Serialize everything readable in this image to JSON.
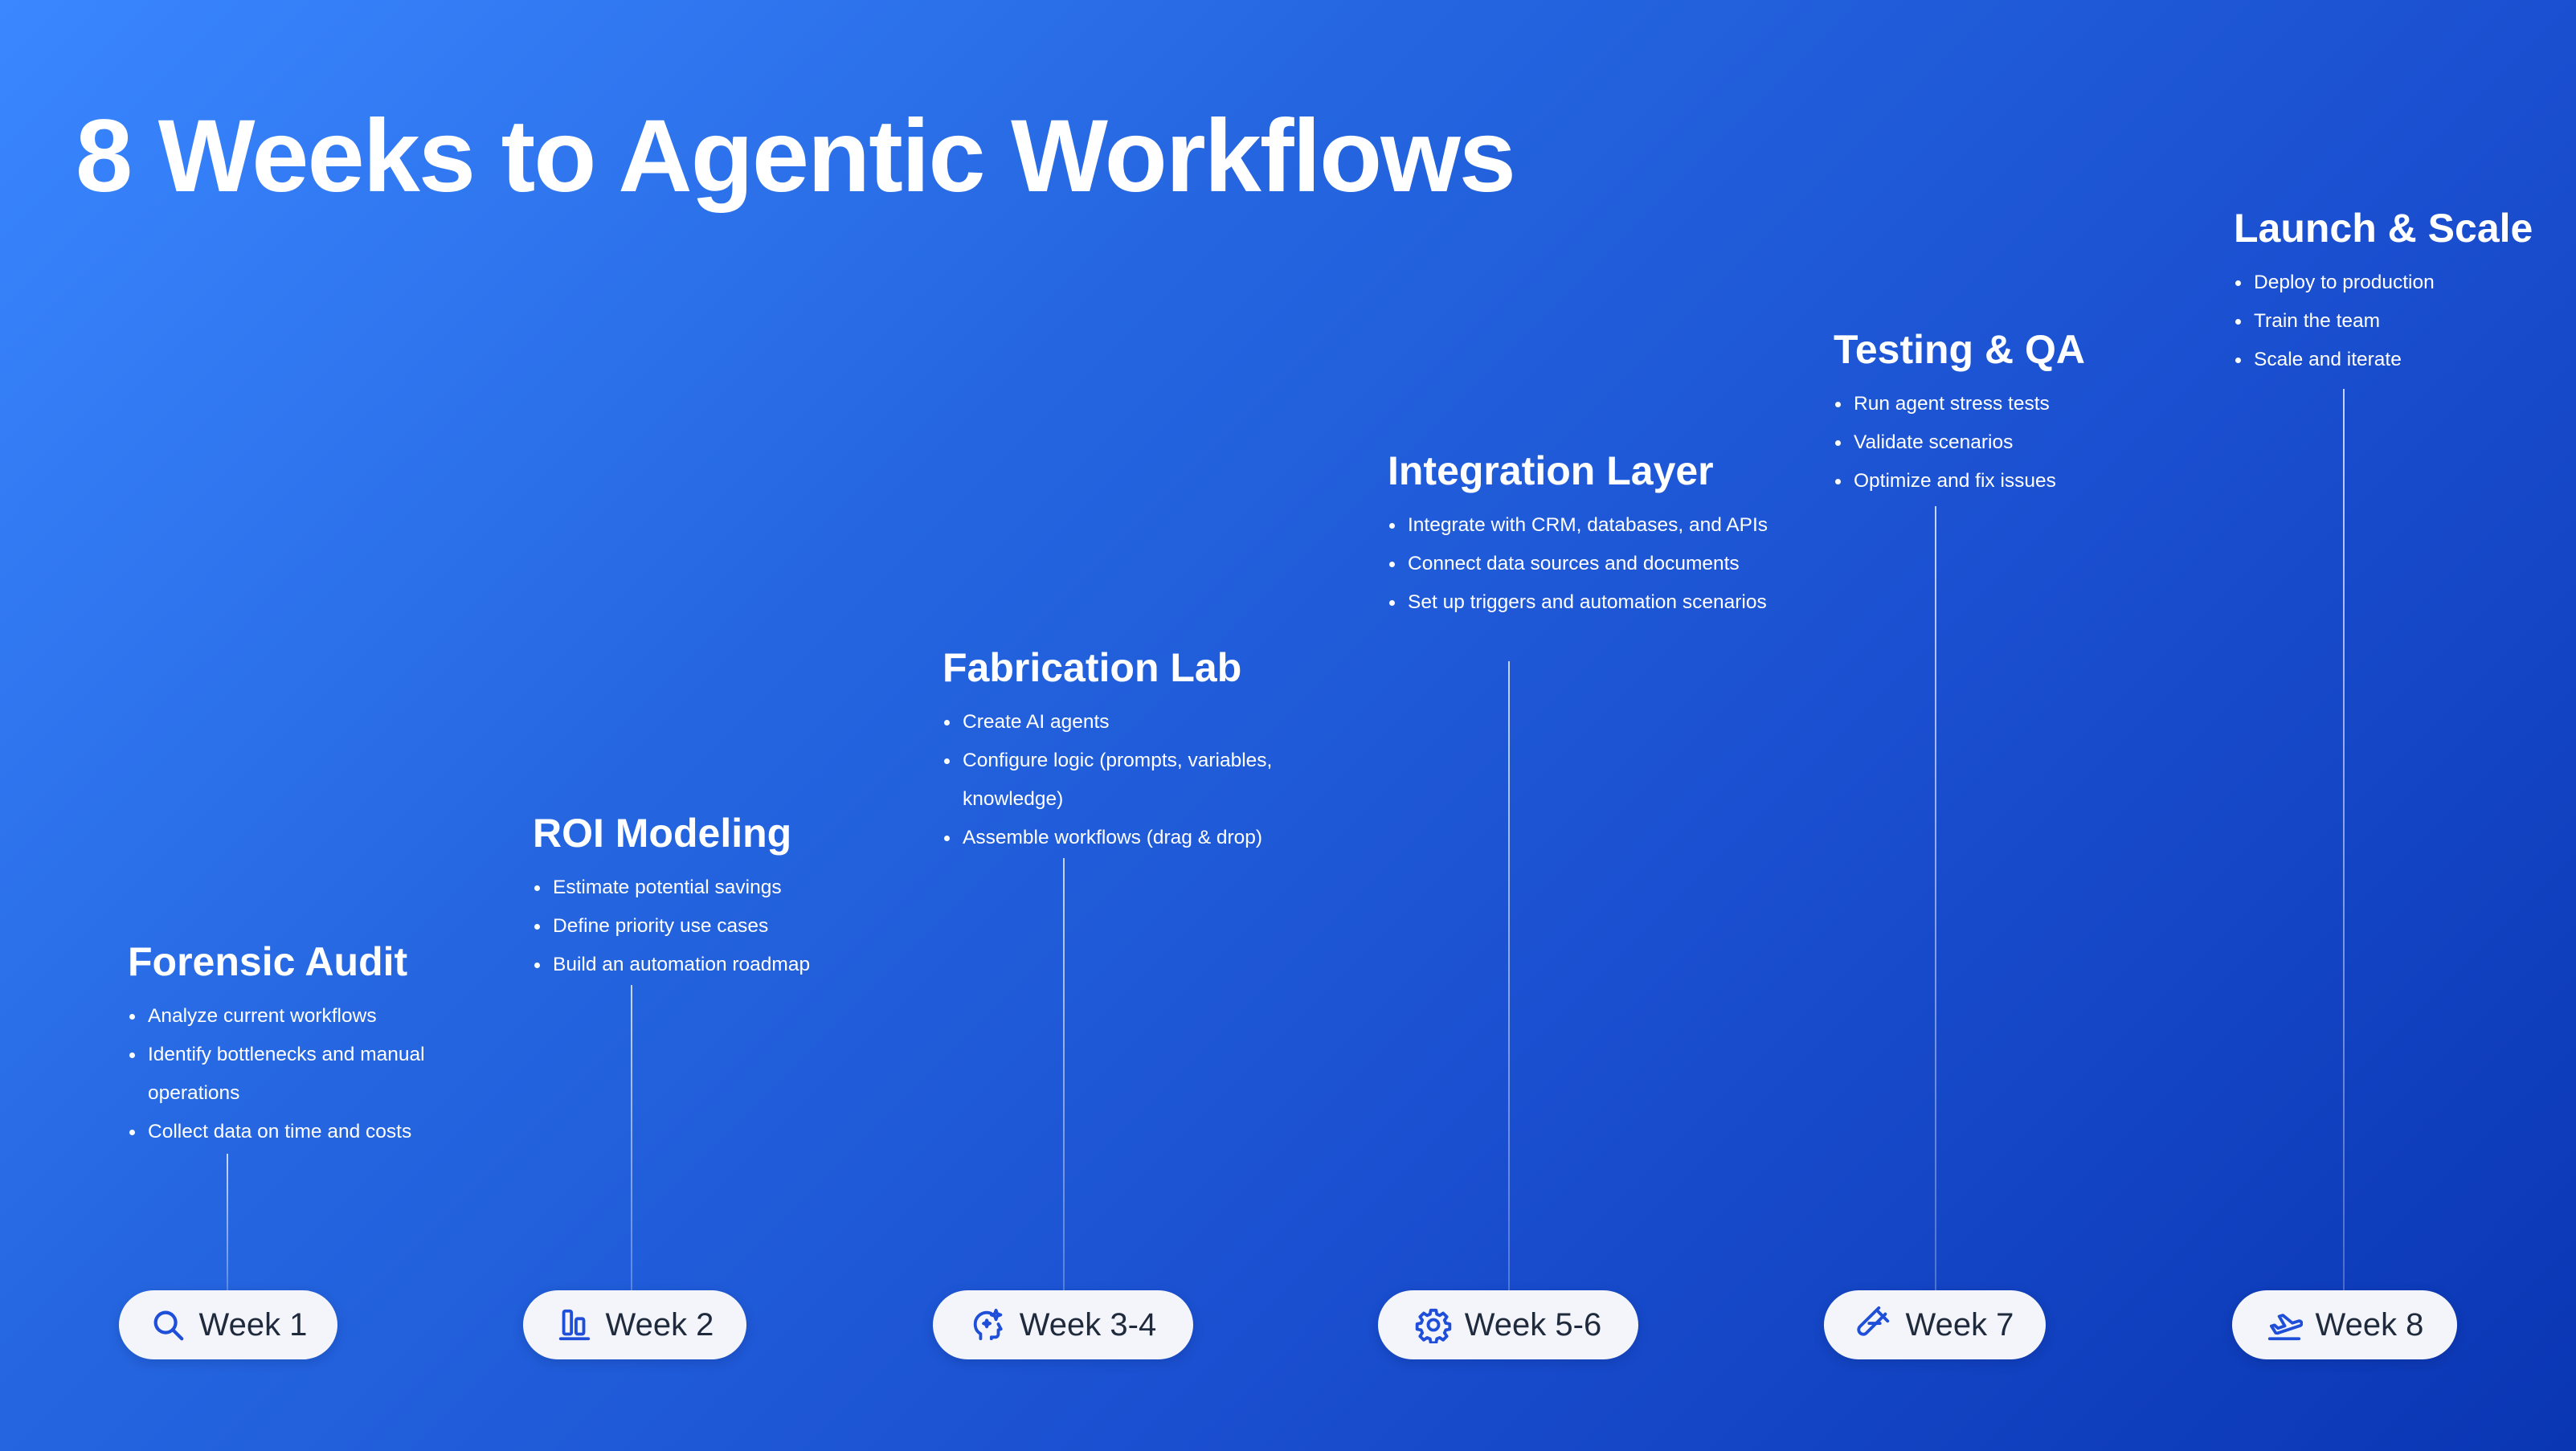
{
  "title": "8 Weeks to Agentic Workflows",
  "colors": {
    "icon": "#1f4fd8",
    "pill_bg": "#f3f5fa",
    "pill_text": "#1f2a3d"
  },
  "phases": [
    {
      "title": "Forensic Audit",
      "items": [
        "Analyze current workflows",
        "Identify bottlenecks and manual operations",
        "Collect data on time and costs"
      ],
      "week": "Week 1",
      "icon": "search-icon"
    },
    {
      "title": "ROI Modeling",
      "items": [
        "Estimate potential savings",
        "Define priority use cases",
        "Build an automation roadmap"
      ],
      "week": "Week 2",
      "icon": "bar-align-icon"
    },
    {
      "title": "Fabrication Lab",
      "items": [
        "Create AI agents",
        "Configure logic (prompts, variables, knowledge)",
        "Assemble workflows (drag & drop)"
      ],
      "week": "Week 3-4",
      "icon": "ai-head-sparkle-icon"
    },
    {
      "title": "Integration Layer",
      "items": [
        "Integrate with CRM, databases, and APIs",
        "Connect data sources and documents",
        "Set up triggers and automation scenarios"
      ],
      "week": "Week 5-6",
      "icon": "gear-icon"
    },
    {
      "title": "Testing & QA",
      "items": [
        "Run agent stress tests",
        "Validate scenarios",
        "Optimize and fix issues"
      ],
      "week": "Week 7",
      "icon": "test-tube-icon"
    },
    {
      "title": "Launch & Scale",
      "items": [
        "Deploy to production",
        "Train the team",
        "Scale and iterate"
      ],
      "week": "Week 8",
      "icon": "plane-takeoff-icon"
    }
  ]
}
